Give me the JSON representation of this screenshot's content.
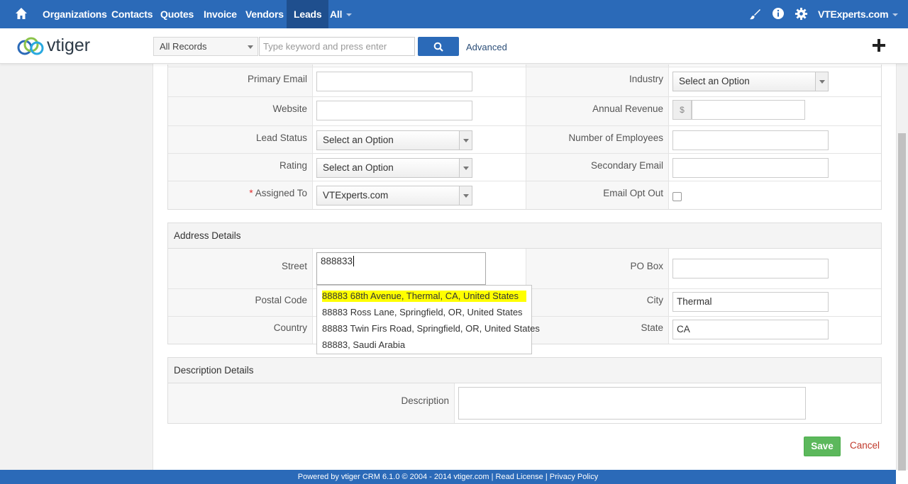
{
  "nav": {
    "items": [
      "Organizations",
      "Contacts",
      "Quotes",
      "Invoice",
      "Vendors",
      "Leads",
      "All"
    ],
    "active": "Leads",
    "user": "VTExperts.com"
  },
  "toolbar": {
    "logo": "vtiger",
    "records_select": "All Records",
    "search_placeholder": "Type keyword and press enter",
    "advanced": "Advanced"
  },
  "form": {
    "left_fields": [
      {
        "label": "Primary Email",
        "value": ""
      },
      {
        "label": "Website",
        "value": ""
      },
      {
        "label": "Lead Status",
        "value": "Select an Option"
      },
      {
        "label": "Rating",
        "value": "Select an Option"
      },
      {
        "label": "Assigned To",
        "value": "VTExperts.com",
        "required": "*"
      }
    ],
    "right_fields": [
      {
        "label": "Industry",
        "value": "Select an Option"
      },
      {
        "label": "Annual Revenue",
        "value": "",
        "prefix": "$"
      },
      {
        "label": "Number of Employees",
        "value": ""
      },
      {
        "label": "Secondary Email",
        "value": ""
      },
      {
        "label": "Email Opt Out",
        "value": ""
      }
    ]
  },
  "address": {
    "header": "Address Details",
    "street_label": "Street",
    "street_value": "888833",
    "po_box_label": "PO Box",
    "postal_label": "Postal Code",
    "city_label": "City",
    "city_value": "Thermal",
    "country_label": "Country",
    "state_label": "State",
    "state_value": "CA",
    "suggestions": [
      "88883 68th Avenue, Thermal, CA, United States",
      "88883 Ross Lane, Springfield, OR, United States",
      "88883 Twin Firs Road, Springfield, OR, United States",
      "88883, Saudi Arabia"
    ]
  },
  "description": {
    "header": "Description Details",
    "label": "Description"
  },
  "actions": {
    "save": "Save",
    "cancel": "Cancel"
  },
  "footer": "Powered by vtiger CRM 6.1.0  © 2004 - 2014  vtiger.com | Read License | Privacy Policy",
  "colors": {
    "nav": "#2b6ab8",
    "save": "#5cb85c",
    "highlight": "#ffff00"
  }
}
